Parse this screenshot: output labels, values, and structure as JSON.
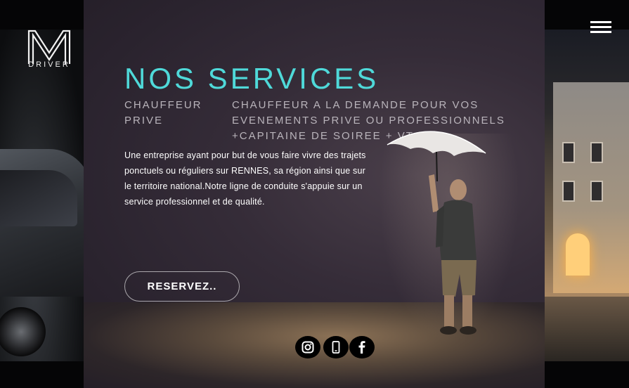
{
  "header": {
    "logo_text": "DRIVER",
    "menu_label": "menu"
  },
  "main": {
    "title": "NOS SERVICES",
    "subtitle_left": [
      "CHAUFFEUR",
      "PRIVE"
    ],
    "subtitle_right": [
      "CHAUFFEUR A LA DEMANDE POUR VOS",
      "EVENEMENTS PRIVE OU PROFESSIONNELS",
      "+CAPITAINE DE SOIREE + VTC"
    ],
    "description": "Une entreprise ayant pour but de vous faire vivre des trajets ponctuels ou réguliers sur RENNES, sa région ainsi que sur le territoire national.Notre ligne de conduite s'appuie sur un service professionnel et de qualité.",
    "cta_label": "RESERVEZ.."
  },
  "social": [
    {
      "icon": "instagram-icon"
    },
    {
      "icon": "phone-icon"
    },
    {
      "icon": "facebook-icon"
    }
  ],
  "colors": {
    "accent": "#4fd9d9",
    "panel": "#2f2733",
    "text_muted": "#b9b4bb"
  }
}
